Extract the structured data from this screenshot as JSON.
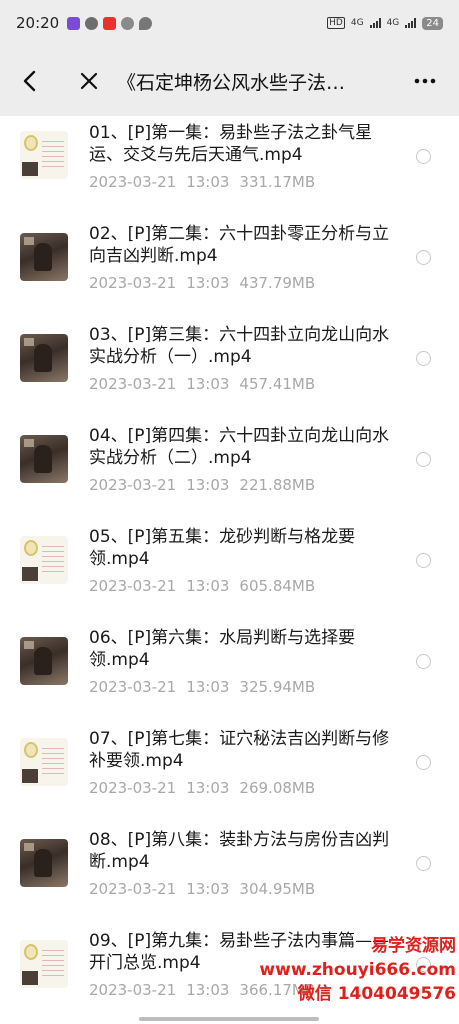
{
  "status_bar": {
    "time": "20:20",
    "network_1": "4G",
    "network_2": "4G",
    "hd": "HD",
    "battery": "24"
  },
  "nav": {
    "title": "《石定坤杨公风水些子法…",
    "back_icon": "back-arrow",
    "close_icon": "close-x",
    "more_icon": "more-dots"
  },
  "files": [
    {
      "name": "01、[P]第一集：易卦些子法之卦气星运、交爻与先后天通气.mp4",
      "date": "2023-03-21",
      "time": "13:03",
      "size": "331.17MB",
      "thumb": "doc"
    },
    {
      "name": "02、[P]第二集：六十四卦零正分析与立向吉凶判断.mp4",
      "date": "2023-03-21",
      "time": "13:03",
      "size": "437.79MB",
      "thumb": "video"
    },
    {
      "name": "03、[P]第三集：六十四卦立向龙山向水实战分析（一）.mp4",
      "date": "2023-03-21",
      "time": "13:03",
      "size": "457.41MB",
      "thumb": "video"
    },
    {
      "name": "04、[P]第四集：六十四卦立向龙山向水实战分析（二）.mp4",
      "date": "2023-03-21",
      "time": "13:03",
      "size": "221.88MB",
      "thumb": "video"
    },
    {
      "name": "05、[P]第五集：龙砂判断与格龙要领.mp4",
      "date": "2023-03-21",
      "time": "13:03",
      "size": "605.84MB",
      "thumb": "doc"
    },
    {
      "name": "06、[P]第六集：水局判断与选择要领.mp4",
      "date": "2023-03-21",
      "time": "13:03",
      "size": "325.94MB",
      "thumb": "video"
    },
    {
      "name": "07、[P]第七集：证穴秘法吉凶判断与修补要领.mp4",
      "date": "2023-03-21",
      "time": "13:03",
      "size": "269.08MB",
      "thumb": "doc"
    },
    {
      "name": "08、[P]第八集：装卦方法与房份吉凶判断.mp4",
      "date": "2023-03-21",
      "time": "13:03",
      "size": "304.95MB",
      "thumb": "video"
    },
    {
      "name": "09、[P]第九集：易卦些子法内事篇——开门总览.mp4",
      "date": "2023-03-21",
      "time": "13:03",
      "size": "366.17MB",
      "thumb": "doc"
    }
  ],
  "watermark": {
    "line1": "易学资源网",
    "line2": "www.zhouyi666.com",
    "line3": "微信 1404049576"
  },
  "colors": {
    "bar_bg": "#ededed",
    "meta_text": "#a8a8a8",
    "watermark": "#e0201a"
  }
}
